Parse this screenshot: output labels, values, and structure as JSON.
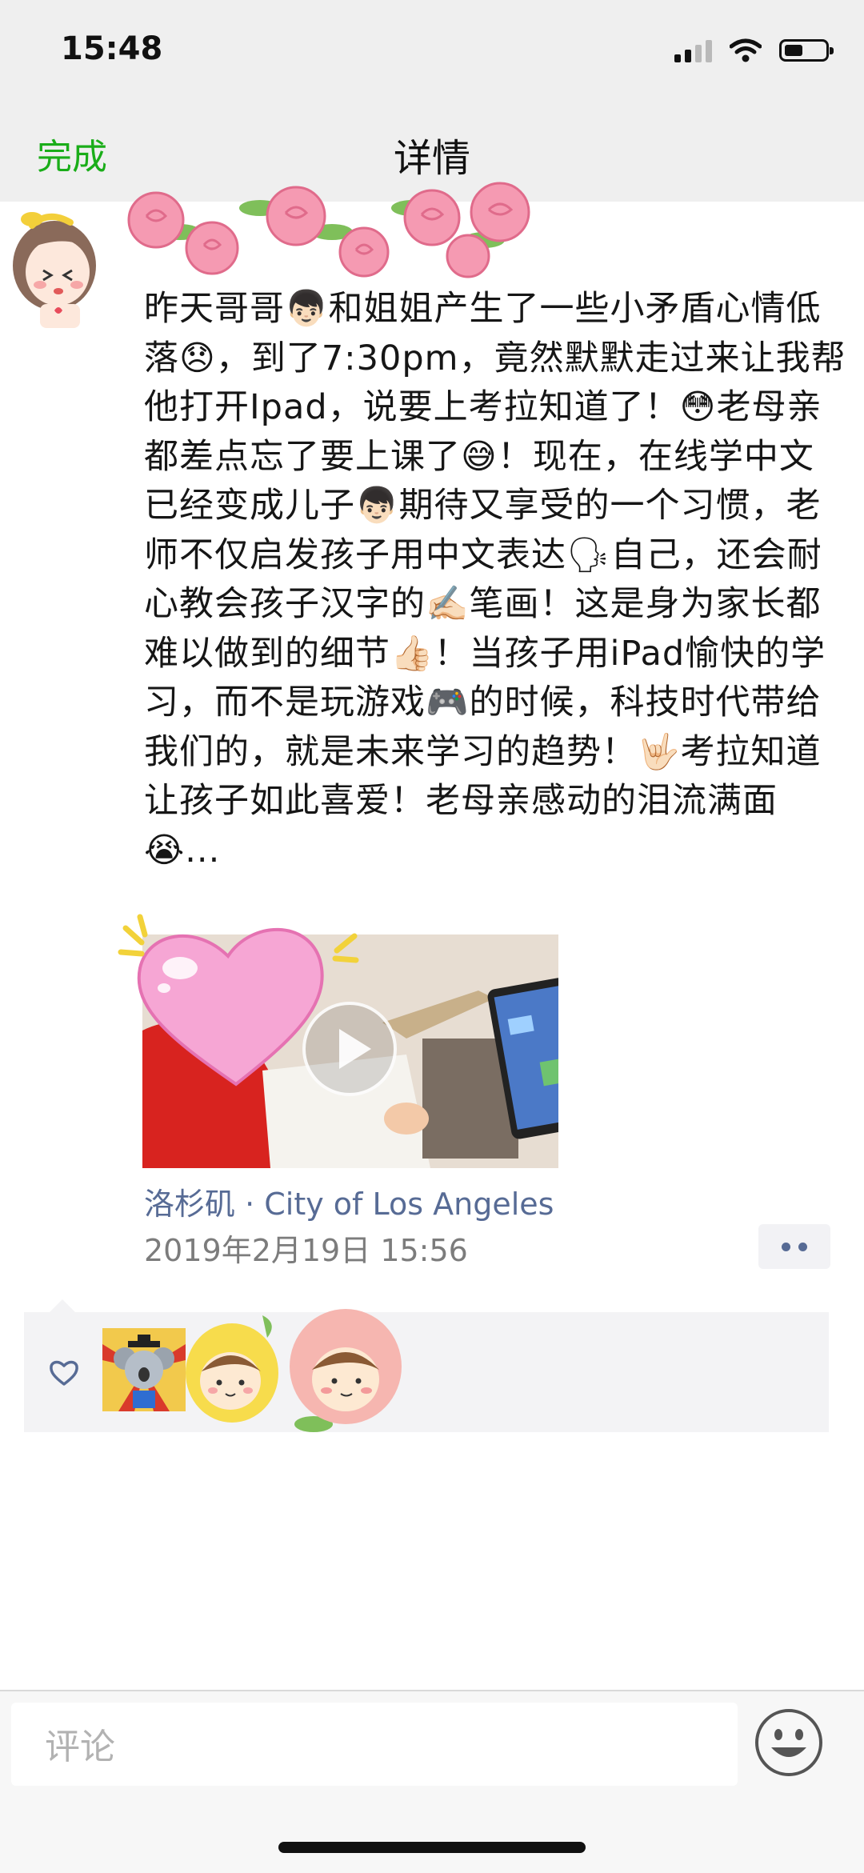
{
  "status_bar": {
    "time": "15:48",
    "icons": [
      "signal-icon",
      "wifi-icon",
      "battery-icon"
    ]
  },
  "nav": {
    "back_label": "完成",
    "title": "详情"
  },
  "post": {
    "text": "昨天哥哥👦🏻和姐姐产生了一些小矛盾心情低落😞，到了7:30pm，竟然默默走过来让我帮他打开Ipad，说要上考拉知道了！😳老母亲都差点忘了要上课了😅！现在，在线学中文已经变成儿子👦🏻期待又享受的一个习惯，老师不仅启发孩子用中文表达🗣自己，还会耐心教会孩子汉字的✍🏻笔画！这是身为家长都难以做到的细节👍🏻！当孩子用iPad愉快的学习，而不是玩游戏🎮的时候，科技时代带给我们的，就是未来学习的趋势！🤟🏻考拉知道让孩子如此喜爱！老母亲感动的泪流满面😭...",
    "video_icon": "play-icon",
    "location": "洛杉矶 · City of Los Angeles",
    "timestamp": "2019年2月19日 15:56"
  },
  "likes": {
    "icon": "heart-outline-icon",
    "avatars": [
      "koala-avatar",
      "lemon-girl-avatar",
      "peach-girl-avatar"
    ]
  },
  "comment": {
    "placeholder": "评论",
    "emoji_icon": "smiley-icon"
  },
  "colors": {
    "accent_green": "#1aad19",
    "link_blue": "#576b95",
    "header_bg": "#efefef",
    "panel_bg": "#f3f3f5"
  }
}
